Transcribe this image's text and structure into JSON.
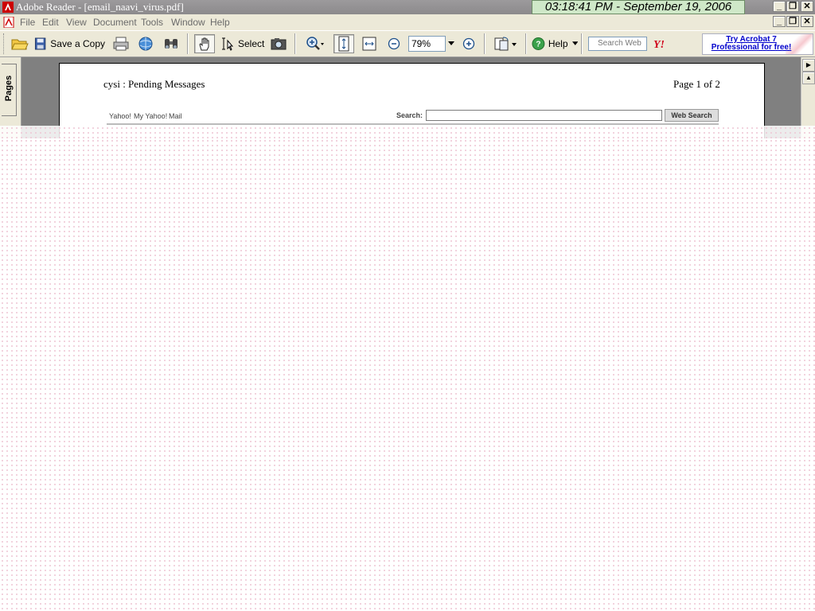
{
  "window": {
    "title": "Adobe Reader - [email_naavi_virus.pdf]",
    "clock": "03:18:41 PM - September 19, 2006"
  },
  "menu": [
    "File",
    "Edit",
    "View",
    "Document",
    "Tools",
    "Window",
    "Help"
  ],
  "toolbar": {
    "save_copy_label": "Save a Copy",
    "select_label": "Select",
    "zoom_value": "79%",
    "help_label": "Help",
    "search_placeholder": "Search Web",
    "ad_text": "Try Acrobat 7 Professional for free!"
  },
  "nav": {
    "pages_tab": "Pages"
  },
  "document": {
    "header_left": "cysi : Pending Messages",
    "header_right": "Page 1 of 2",
    "links": [
      "Yahoo!",
      "My Yahoo!",
      "Mail"
    ],
    "search_label": "Search:",
    "search_button": "Web Search"
  },
  "colors": {
    "titlebar": "#8c8a8c",
    "clock_bg": "#cfe8c8",
    "overlay_dot": "#efc8d6",
    "link_blue": "#0000cc"
  }
}
